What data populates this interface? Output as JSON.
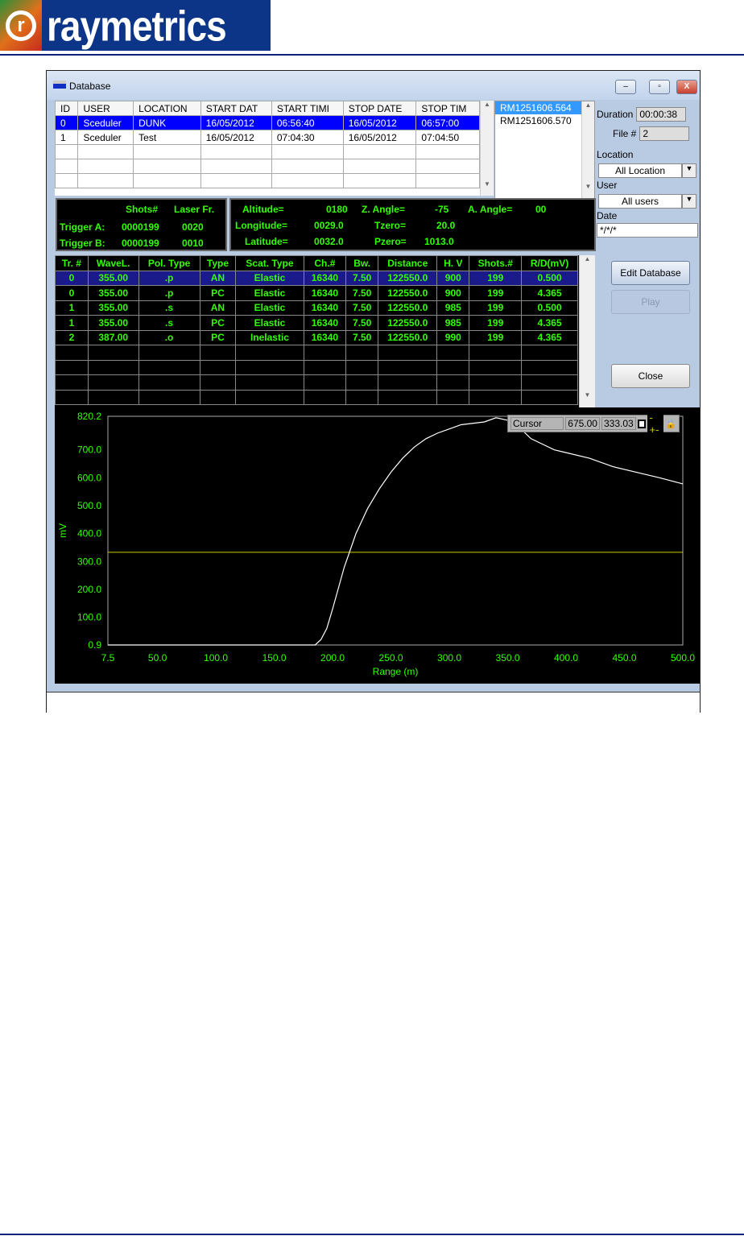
{
  "brand": {
    "logo_text": "raymetrics"
  },
  "window": {
    "title": "Database",
    "min": "–",
    "max": "▫",
    "close": "X"
  },
  "runs": {
    "columns": [
      "ID",
      "USER",
      "LOCATION",
      "START DAT",
      "START TIMI",
      "STOP DATE",
      "STOP TIM"
    ],
    "rows": [
      [
        "0",
        "Sceduler",
        "DUNK",
        "16/05/2012",
        "06:56:40",
        "16/05/2012",
        "06:57:00"
      ],
      [
        "1",
        "Sceduler",
        "Test",
        "16/05/2012",
        "07:04:30",
        "16/05/2012",
        "07:04:50"
      ]
    ],
    "selected": 0
  },
  "files": {
    "items": [
      "RM1251606.564",
      "RM1251606.570"
    ],
    "selected": 0
  },
  "side": {
    "duration_label": "Duration",
    "duration": "00:00:38",
    "file_label": "File #",
    "file": "2",
    "location_label": "Location",
    "location": "All Location",
    "user_label": "User",
    "user": "All users",
    "date_label": "Date",
    "date": "*/*/*"
  },
  "trigger": {
    "shots_h": "Shots#",
    "laser_h": "Laser Fr.",
    "a_label": "Trigger A:",
    "a_shots": "0000199",
    "a_laser": "0020",
    "b_label": "Trigger B:",
    "b_shots": "0000199",
    "b_laser": "0010"
  },
  "geo": {
    "alt_l": "Altitude=",
    "alt": "0180",
    "za_l": "Z. Angle=",
    "za": "-75",
    "aa_l": "A. Angle=",
    "aa": "00",
    "lon_l": "Longitude=",
    "lon": "0029.0",
    "tz_l": "Tzero=",
    "tz": "20.0",
    "lat_l": "Latitude=",
    "lat": "0032.0",
    "pz_l": "Pzero=",
    "pz": "1013.0"
  },
  "channels": {
    "columns": [
      "Tr. #",
      "WaveL.",
      "Pol. Type",
      "Type",
      "Scat. Type",
      "Ch.#",
      "Bw.",
      "Distance",
      "H. V",
      "Shots.#",
      "R/D(mV)"
    ],
    "rows": [
      [
        "0",
        "355.00",
        ".p",
        "AN",
        "Elastic",
        "16340",
        "7.50",
        "122550.0",
        "900",
        "199",
        "0.500"
      ],
      [
        "0",
        "355.00",
        ".p",
        "PC",
        "Elastic",
        "16340",
        "7.50",
        "122550.0",
        "900",
        "199",
        "4.365"
      ],
      [
        "1",
        "355.00",
        ".s",
        "AN",
        "Elastic",
        "16340",
        "7.50",
        "122550.0",
        "985",
        "199",
        "0.500"
      ],
      [
        "1",
        "355.00",
        ".s",
        "PC",
        "Elastic",
        "16340",
        "7.50",
        "122550.0",
        "985",
        "199",
        "4.365"
      ],
      [
        "2",
        "387.00",
        ".o",
        "PC",
        "Inelastic",
        "16340",
        "7.50",
        "122550.0",
        "990",
        "199",
        "4.365"
      ]
    ],
    "empty_rows": 4,
    "selected": 0
  },
  "buttons": {
    "edit": "Edit Database",
    "play": "Play",
    "close": "Close"
  },
  "cursor": {
    "label": "Cursor",
    "x": "675.00",
    "y": "333.03"
  },
  "chart_data": {
    "type": "line",
    "xlabel": "Range (m)",
    "ylabel": "mV",
    "xlim": [
      7.5,
      500
    ],
    "ylim": [
      0.9,
      820.2
    ],
    "xticks": [
      "7.5",
      "50.0",
      "100.0",
      "150.0",
      "200.0",
      "250.0",
      "300.0",
      "350.0",
      "400.0",
      "450.0",
      "500.0"
    ],
    "yticks": [
      "0.9",
      "100.0",
      "200.0",
      "300.0",
      "400.0",
      "500.0",
      "600.0",
      "700.0",
      "820.2"
    ],
    "cursor_y": 333.03,
    "colors": {
      "line": "#ffffff",
      "cursor": "#cccc00",
      "axis_text": "#33ff00"
    },
    "x": [
      7.5,
      180,
      185,
      190,
      195,
      200,
      210,
      220,
      230,
      240,
      250,
      260,
      270,
      280,
      290,
      300,
      310,
      320,
      330,
      340,
      350,
      360,
      370,
      380,
      390,
      400,
      420,
      440,
      460,
      480,
      500
    ],
    "y": [
      0.9,
      0.9,
      0.9,
      20,
      60,
      130,
      280,
      400,
      490,
      560,
      620,
      670,
      710,
      740,
      760,
      775,
      790,
      795,
      800,
      815,
      806,
      780,
      740,
      720,
      700,
      690,
      670,
      640,
      620,
      600,
      578
    ]
  }
}
